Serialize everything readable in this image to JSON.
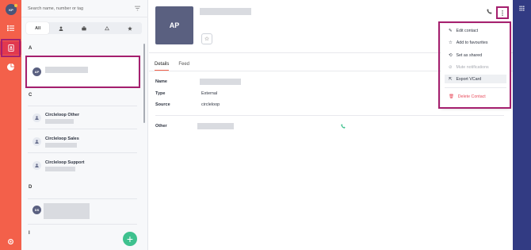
{
  "rail": {
    "user_initials": "KP"
  },
  "list": {
    "search_placeholder": "Search name, number or tag",
    "tabs": [
      {
        "label": "All"
      }
    ],
    "sections": {
      "a": "A",
      "c": "C",
      "d": "D",
      "i": "I"
    },
    "contacts": [
      {
        "initials": "AP"
      },
      {
        "name": "Circleloop Other"
      },
      {
        "name": "Circleloop Sales"
      },
      {
        "name": "Circleloop Support"
      },
      {
        "initials": "DS"
      }
    ],
    "add_button": "+"
  },
  "contact": {
    "initials": "AP",
    "tabs": [
      "Details",
      "Feed"
    ],
    "fields": {
      "name_label": "Name",
      "type_label": "Type",
      "type_value": "External",
      "source_label": "Source",
      "source_value": "circleloop",
      "other_label": "Other"
    }
  },
  "menu": {
    "items": [
      {
        "label": "Edit contact",
        "icon": "pencil-icon"
      },
      {
        "label": "Add to favourites",
        "icon": "star-icon"
      },
      {
        "label": "Set as shared",
        "icon": "share-icon"
      },
      {
        "label": "Mute notifications",
        "icon": "mute-icon"
      },
      {
        "label": "Export VCard",
        "icon": "export-icon"
      },
      {
        "label": "Delete Contact",
        "icon": "trash-icon"
      }
    ]
  },
  "colors": {
    "rail": "#f3604a",
    "rail_active": "#e1384f",
    "highlight": "#a51f6e",
    "right_rail": "#323b83",
    "accent_green": "#3ec18e",
    "danger": "#e84c5c"
  }
}
